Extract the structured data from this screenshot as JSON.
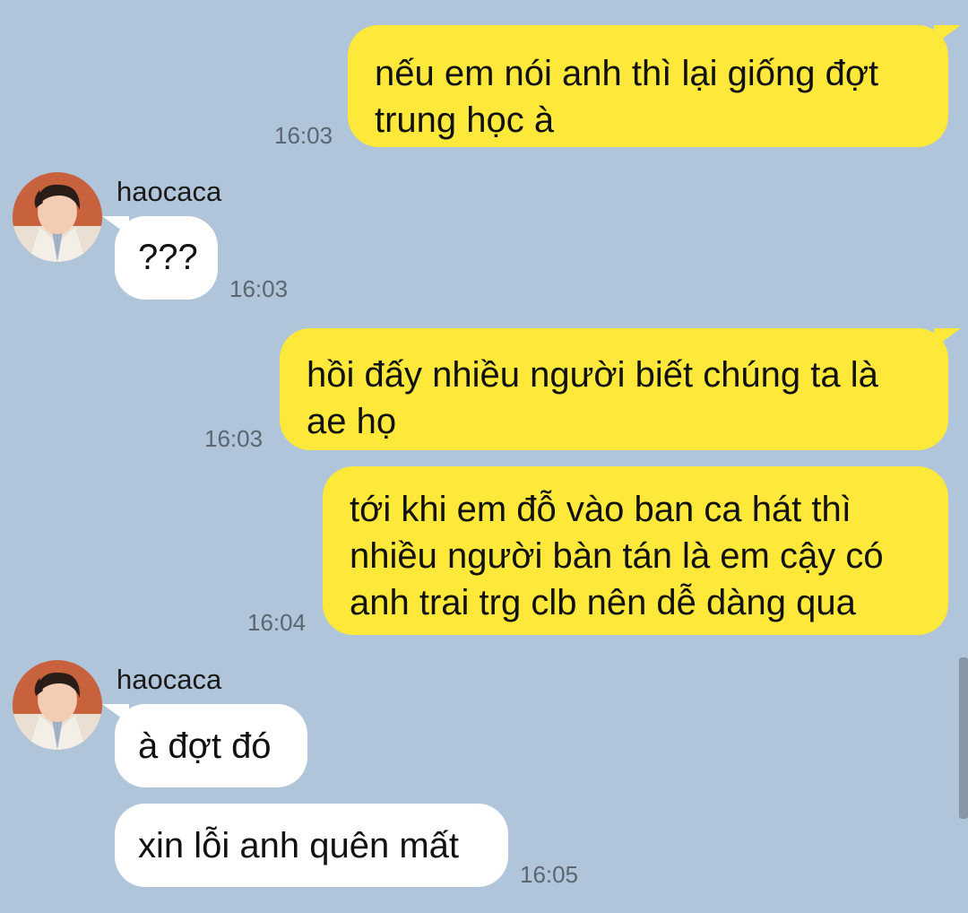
{
  "contact": {
    "name": "haocaca"
  },
  "messages": [
    {
      "dir": "out",
      "text": "nếu em nói anh thì lại giống đợt\ntrung học à",
      "time": "16:03"
    },
    {
      "dir": "in",
      "sender": "haocaca",
      "text": "???",
      "time": "16:03"
    },
    {
      "dir": "out",
      "text": "hồi đấy nhiều người biết chúng ta là\nae họ",
      "time": "16:03"
    },
    {
      "dir": "out",
      "text": "tới khi em đỗ vào ban ca hát thì\nnhiều người bàn tán là em cậy có\nanh trai trg clb nên dễ dàng qua",
      "time": "16:04"
    },
    {
      "dir": "in",
      "sender": "haocaca",
      "text": "à đợt đó",
      "time": ""
    },
    {
      "dir": "in",
      "text": "xin lỗi anh quên mất",
      "time": "16:05"
    }
  ],
  "colors": {
    "background": "#b0c5d9",
    "outgoing_bubble": "#fee83a",
    "incoming_bubble": "#ffffff",
    "timestamp": "#5b6670"
  },
  "icons": {
    "avatar": "profile-photo-avatar"
  }
}
